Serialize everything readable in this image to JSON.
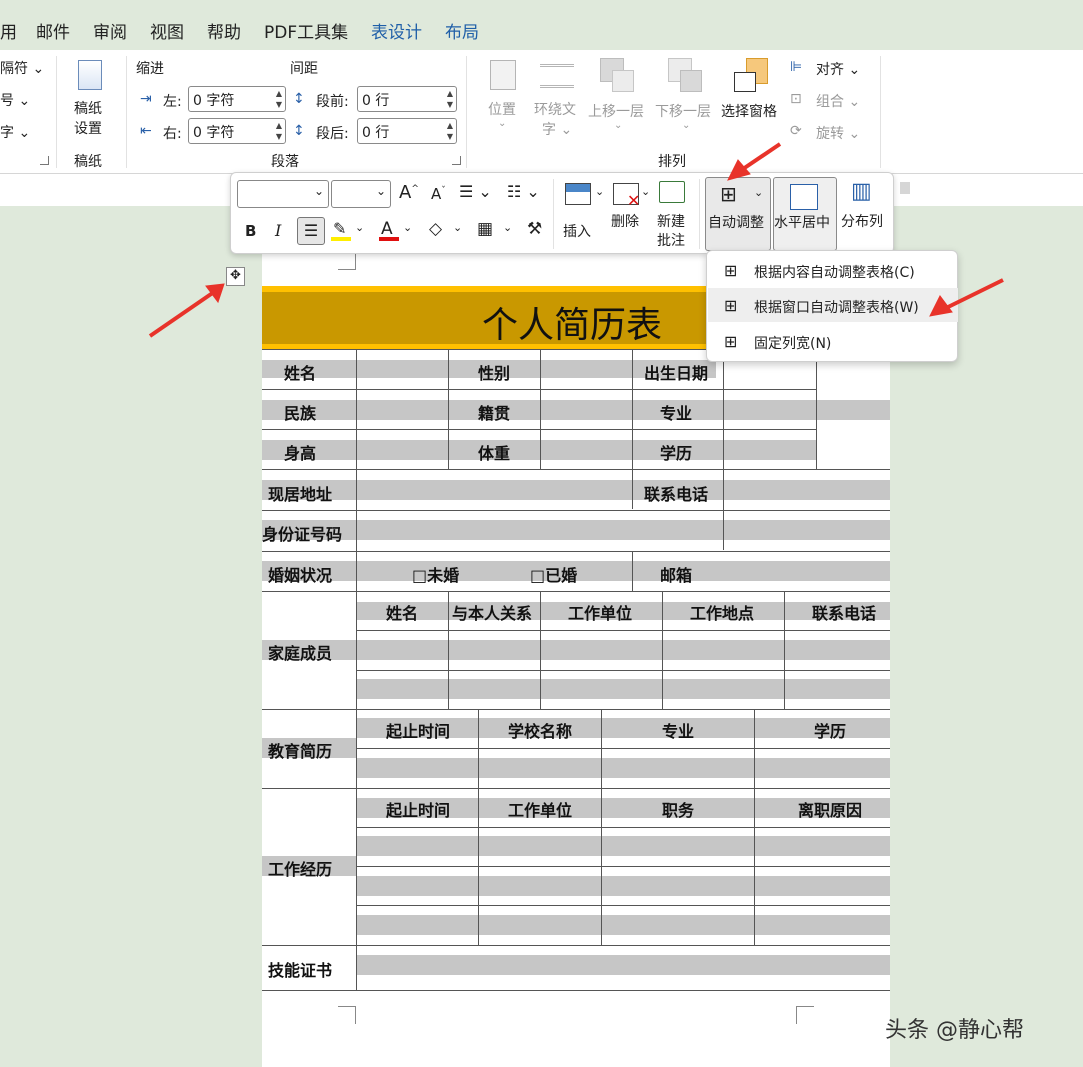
{
  "menu": [
    "用",
    "邮件",
    "审阅",
    "视图",
    "帮助",
    "PDF工具集",
    "表设计",
    "布局"
  ],
  "ribbon": {
    "left_partial": [
      "隔符",
      "号",
      "字"
    ],
    "gaozhi": {
      "button": "稿纸\n设置",
      "button_l1": "稿纸",
      "button_l2": "设置",
      "group": "稿纸"
    },
    "paragraph": {
      "indent_label": "缩进",
      "spacing_label": "间距",
      "left_label": "左:",
      "left_value": "0 字符",
      "right_label": "右:",
      "right_value": "0 字符",
      "before_label": "段前:",
      "before_value": "0 行",
      "after_label": "段后:",
      "after_value": "0 行",
      "group": "段落"
    },
    "arrange": {
      "position": "位置",
      "wrap_l1": "环绕文",
      "wrap_l2": "字",
      "forward": "上移一层",
      "backward": "下移一层",
      "selection_pane": "选择窗格",
      "align": "对齐",
      "group_btn": "组合",
      "rotate": "旋转",
      "group": "排列"
    }
  },
  "mini_toolbar": {
    "bold": "B",
    "italic": "I",
    "font_grow": "A",
    "font_shrink": "A",
    "insert": "插入",
    "delete": "删除",
    "new_comment_l1": "新建",
    "new_comment_l2": "批注",
    "autofit": "自动调整",
    "center": "水平居中",
    "distribute": "分布列",
    "highlight_color": "#ffee00",
    "font_color": "#e01010"
  },
  "autofit_menu": [
    {
      "label": "根据内容自动调整表格(C)"
    },
    {
      "label": "根据窗口自动调整表格(W)"
    },
    {
      "label": "固定列宽(N)"
    }
  ],
  "resume": {
    "title": "个人简历表",
    "r_name": "姓名",
    "r_gender": "性别",
    "r_birth": "出生日期",
    "r_ethnic": "民族",
    "r_origin": "籍贯",
    "r_major": "专业",
    "r_height": "身高",
    "r_weight": "体重",
    "r_edu": "学历",
    "r_address": "现居地址",
    "r_phone": "联系电话",
    "r_id": "身份证号码",
    "r_marital": "婚姻状况",
    "r_unmarried": "□未婚",
    "r_married": "□已婚",
    "r_email": "邮箱",
    "family": {
      "label": "家庭成员",
      "headers": [
        "姓名",
        "与本人关系",
        "工作单位",
        "工作地点",
        "联系电话"
      ]
    },
    "education": {
      "label": "教育简历",
      "headers": [
        "起止时间",
        "学校名称",
        "专业",
        "学历"
      ]
    },
    "work": {
      "label": "工作经历",
      "headers": [
        "起止时间",
        "工作单位",
        "职务",
        "离职原因"
      ]
    },
    "skills": "技能证书",
    "title_bg": "#c99800",
    "title_bar": "#ffc000"
  },
  "watermark": "头条 @静心帮"
}
